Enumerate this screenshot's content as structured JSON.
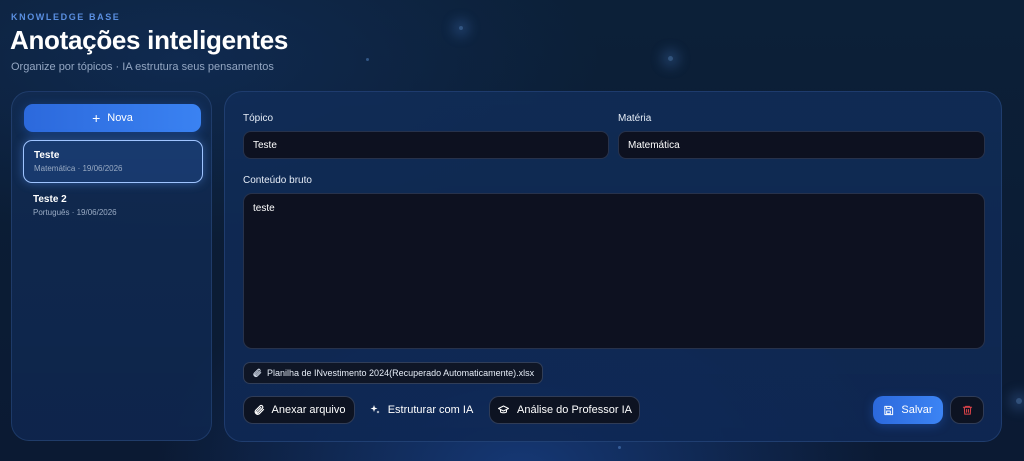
{
  "header": {
    "kicker": "KNOWLEDGE BASE",
    "title": "Anotações inteligentes",
    "subtitle": "Organize por tópicos · IA estrutura seus pensamentos"
  },
  "sidebar": {
    "new_button": {
      "icon": "plus-icon",
      "label": "Nova"
    },
    "notes": [
      {
        "title": "Teste",
        "meta": "Matemática · 19/06/2026",
        "active": true
      },
      {
        "title": "Teste 2",
        "meta": "Português · 19/06/2026",
        "active": false
      }
    ]
  },
  "editor": {
    "topic": {
      "label": "Tópico",
      "value": "Teste"
    },
    "subject": {
      "label": "Matéria",
      "value": "Matemática"
    },
    "content": {
      "label": "Conteúdo bruto",
      "value": "teste"
    },
    "attachment": {
      "icon": "paperclip-icon",
      "filename": "Planilha de INvestimento 2024(Recuperado Automaticamente).xlsx"
    },
    "actions": {
      "attach": {
        "icon": "paperclip-icon",
        "label": "Anexar arquivo"
      },
      "structure": {
        "icon": "sparkles-icon",
        "label": "Estruturar com IA"
      },
      "professor": {
        "icon": "graduation-cap-icon",
        "label": "Análise do Professor IA"
      },
      "save": {
        "icon": "save-icon",
        "label": "Salvar"
      },
      "delete": {
        "icon": "trash-icon"
      }
    }
  },
  "colors": {
    "accent": "#3a7be8",
    "background": "#0b1d35",
    "danger": "#e0444a",
    "kicker": "#5a8fe0"
  }
}
